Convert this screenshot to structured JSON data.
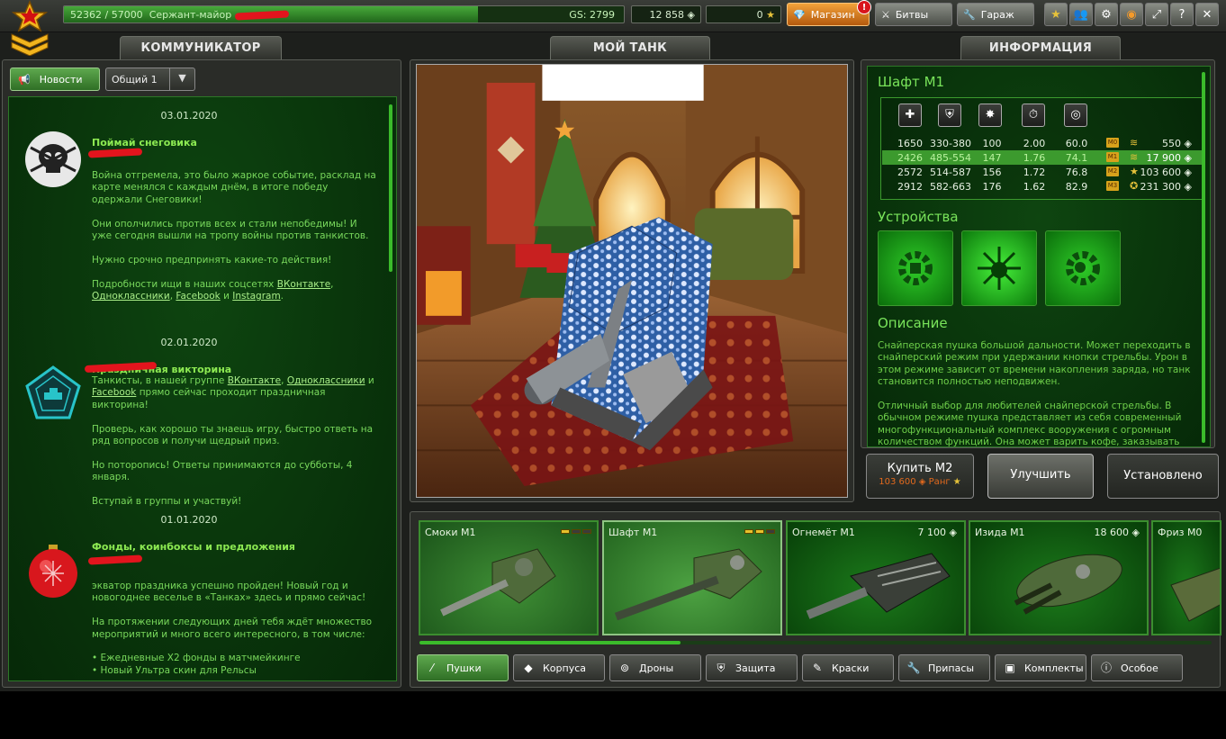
{
  "topbar": {
    "experience": "52362 / 57000",
    "experience_fraction": 0.74,
    "rank_name": "Сержант-майор",
    "gs_label": "GS: 2799",
    "crystals": "12 858",
    "stars": "0",
    "shop_label": "Магазин",
    "shop_badge": "!",
    "battles_label": "Битвы",
    "garage_label": "Гараж",
    "help_label": "?"
  },
  "communicator": {
    "header": "КОММУНИКАТОР",
    "news_tab": "Новости",
    "channel": "Общий 1",
    "news": [
      {
        "date": "03.01.2020",
        "title": "Поймай снеговика",
        "paragraphs": [
          "Война отгремела, это было жаркое событие, расклад на карте менялся с каждым днём, в итоге победу одержали Снеговики!",
          "Они ополчились против всех и стали непобедимы! И уже сегодня вышли на тропу войны против танкистов.",
          "Нужно срочно предпринять какие-то действия!"
        ],
        "links_prefix": "Подробности ищи в наших соцсетях",
        "link_vk": "ВКонтакте",
        "link_ok": "Одноклассники",
        "link_fb": "Facebook",
        "link_and": "и",
        "link_ig": "Instagram"
      },
      {
        "date": "02.01.2020",
        "title": "Праздничная викторина",
        "line1_prefix": "Танкисты, в нашей группе",
        "line1_vk": "ВКонтакте",
        "line1_ok": "Одноклассники",
        "line1_and": "и",
        "line1_fb": "Facebook",
        "line1_suffix": "прямо сейчас проходит праздничная викторина!",
        "paragraphs": [
          "Проверь, как хорошо ты знаешь игру, быстро ответь на ряд вопросов и получи щедрый приз.",
          "Но поторопись! Ответы принимаются до субботы, 4 января.",
          "Вступай в группы и участвуй!"
        ]
      },
      {
        "date": "01.01.2020",
        "title": "Фонды, коинбоксы и предложения",
        "paragraphs": [
          "экватор праздника успешно пройден! Новый год и новогоднее веселье в «Танках» здесь и прямо сейчас!",
          "На протяжении следующих дней тебя ждёт множество мероприятий и много всего интересного, в том числе:"
        ],
        "bullets": [
          "• Ежедневные Х2 фонды в матчмейкинге",
          "• Новый Ультра скин для Рельсы"
        ]
      }
    ]
  },
  "tank": {
    "header": "МОЙ ТАНК"
  },
  "info": {
    "header": "ИНФОРМАЦИЯ",
    "title": "Шафт М1",
    "stat_icons": [
      "damage-icon",
      "armor-damage-icon",
      "impact-icon",
      "reload-icon",
      "aim-icon"
    ],
    "rows": [
      {
        "c1": "1650",
        "c2": "330-380",
        "c3": "100",
        "c4": "2.00",
        "c5": "60.0",
        "mod": "M0",
        "price": "550"
      },
      {
        "c1": "2426",
        "c2": "485-554",
        "c3": "147",
        "c4": "1.76",
        "c5": "74.1",
        "mod": "M1",
        "price": "17 900"
      },
      {
        "c1": "2572",
        "c2": "514-587",
        "c3": "156",
        "c4": "1.72",
        "c5": "76.8",
        "mod": "M2",
        "price": "103 600"
      },
      {
        "c1": "2912",
        "c2": "582-663",
        "c3": "176",
        "c4": "1.62",
        "c5": "82.9",
        "mod": "M3",
        "price": "231 300"
      }
    ],
    "devices_title": "Устройства",
    "description_title": "Описание",
    "description": [
      "Снайперская пушка большой дальности. Может переходить в снайперский режим при удержании кнопки стрельбы. Урон в этом режиме зависит от времени накопления заряда, но танк становится полностью неподвижен.",
      "Отличный выбор для любителей снайперской стрельбы. В обычном режиме пушка представляет из себя современный многофункциональный комплекс вооружения с огромным количеством функций. Она может варить кофе, заказывать пиццу,"
    ]
  },
  "actions": {
    "buy_label": "Купить М2",
    "buy_price": "103 600",
    "buy_rank_label": "Ранг",
    "upgrade_label": "Улучшить",
    "installed_label": "Установлено"
  },
  "items": [
    {
      "name": "Смоки М1",
      "price": ""
    },
    {
      "name": "Шафт М1",
      "price": ""
    },
    {
      "name": "Огнемёт М1",
      "price": "7 100"
    },
    {
      "name": "Изида М1",
      "price": "18 600"
    },
    {
      "name": "Фриз М0",
      "price": ""
    }
  ],
  "categories": [
    "Пушки",
    "Корпуса",
    "Дроны",
    "Защита",
    "Краски",
    "Припасы",
    "Комплекты",
    "Особое"
  ],
  "colors": {
    "accent_green": "#3bbb2b",
    "shop_orange": "#e1861f",
    "alert_red": "#d8151c"
  }
}
